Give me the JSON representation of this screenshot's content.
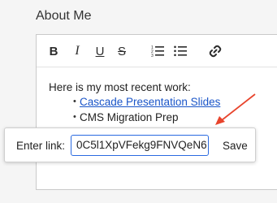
{
  "section": {
    "title": "About Me"
  },
  "toolbar": {
    "bold": "B",
    "italic": "I",
    "underline": "U",
    "strikethrough": "S",
    "icons": [
      "bold-icon",
      "italic-icon",
      "underline-icon",
      "strikethrough-icon",
      "ordered-list-icon",
      "bulleted-list-icon",
      "link-icon"
    ]
  },
  "content": {
    "intro": "Here is my most recent work:",
    "items": [
      {
        "text": "Cascade Presentation Slides",
        "is_link": true
      },
      {
        "text": "CMS Migration Prep",
        "is_link": false
      }
    ]
  },
  "link_popover": {
    "label": "Enter link:",
    "value": "0C5l1XpVFekg9FNVQeN6",
    "save_label": "Save"
  },
  "colors": {
    "link": "#1a55c8",
    "input_border": "#2a6ae0",
    "annotation_arrow": "#e8442c"
  }
}
